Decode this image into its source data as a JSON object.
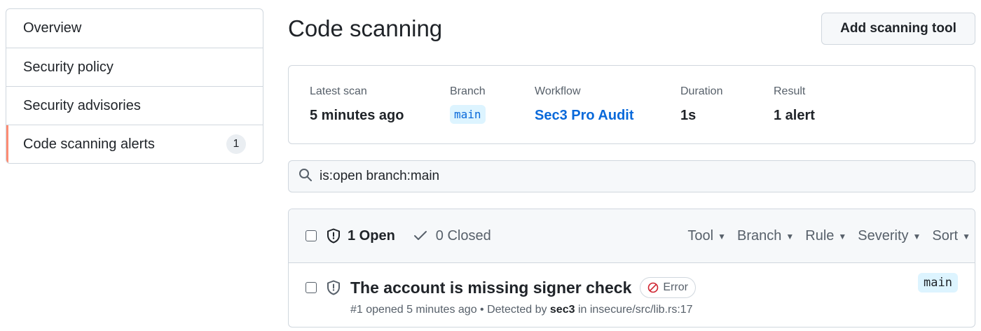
{
  "sidebar": {
    "items": [
      {
        "label": "Overview"
      },
      {
        "label": "Security policy"
      },
      {
        "label": "Security advisories"
      },
      {
        "label": "Code scanning alerts",
        "count": "1",
        "active": true
      }
    ]
  },
  "header": {
    "title": "Code scanning",
    "add_button": "Add scanning tool"
  },
  "scan": {
    "latest_label": "Latest scan",
    "latest_value": "5 minutes ago",
    "branch_label": "Branch",
    "branch_value": "main",
    "workflow_label": "Workflow",
    "workflow_value": "Sec3 Pro Audit",
    "duration_label": "Duration",
    "duration_value": "1s",
    "result_label": "Result",
    "result_value": "1 alert"
  },
  "search": {
    "value": "is:open branch:main"
  },
  "alerts": {
    "open_label": "1 Open",
    "closed_label": "0 Closed",
    "filters": [
      "Tool",
      "Branch",
      "Rule",
      "Severity",
      "Sort"
    ],
    "rows": [
      {
        "title": "The account is missing signer check",
        "severity": "Error",
        "meta_prefix": "#1 opened 5 minutes ago • Detected by ",
        "tool": "sec3",
        "meta_in": " in ",
        "location": "insecure/src/lib.rs:17",
        "branch": "main"
      }
    ]
  },
  "colors": {
    "accent": "#0969da",
    "active_indicator": "#fd8c73",
    "error": "#cf222e"
  }
}
